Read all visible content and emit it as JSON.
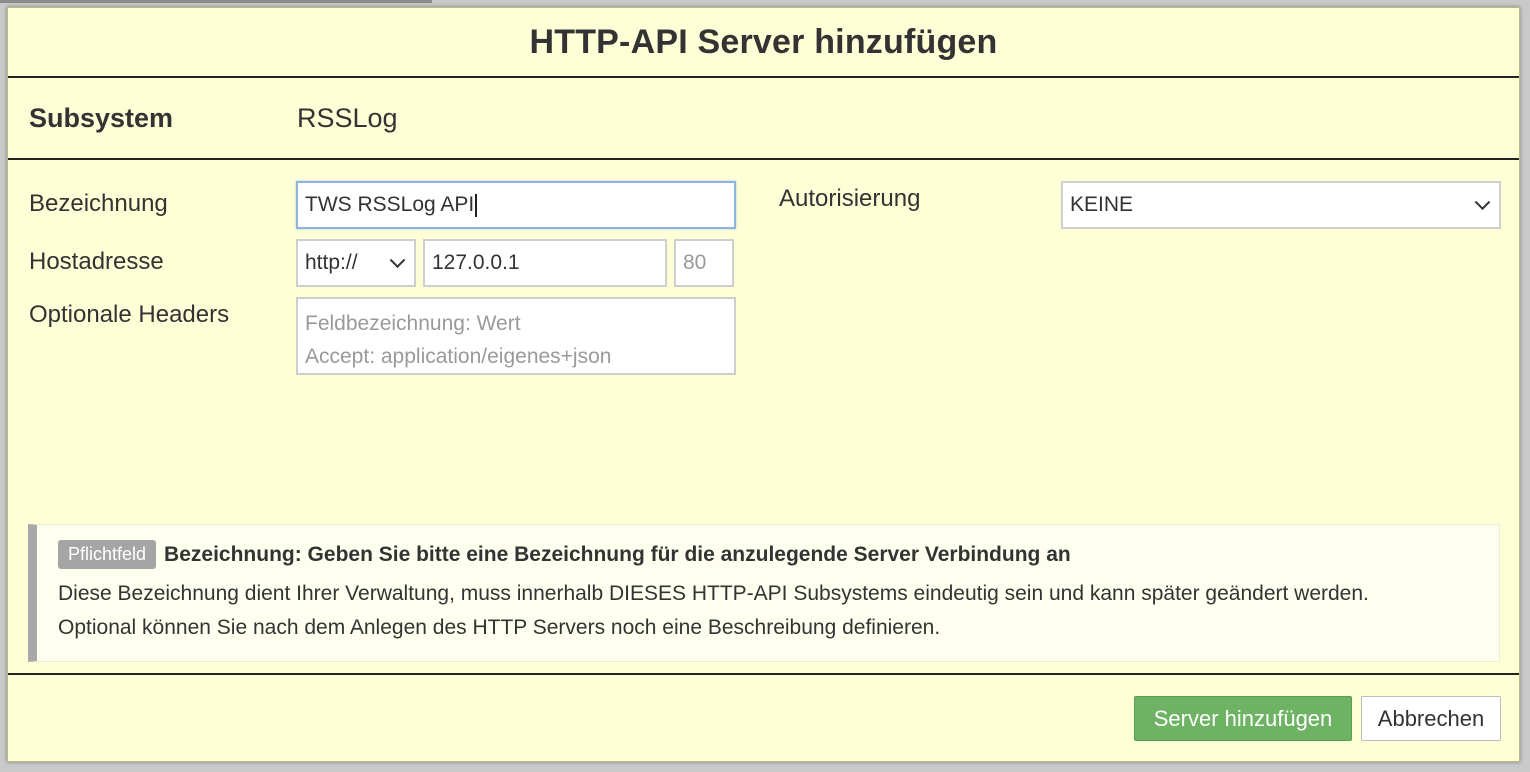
{
  "dialog": {
    "title": "HTTP-API Server hinzufügen",
    "subsystem": {
      "label": "Subsystem",
      "value": "RSSLog"
    }
  },
  "form": {
    "name": {
      "label": "Bezeichnung",
      "value": "TWS RSSLog API"
    },
    "host": {
      "label": "Hostadresse",
      "protocol": "http://",
      "address": "127.0.0.1",
      "port_placeholder": "80"
    },
    "headers": {
      "label": "Optionale Headers",
      "placeholder_line1": "Feldbezeichnung: Wert",
      "placeholder_line2": "Accept: application/eigenes+json"
    },
    "auth": {
      "label": "Autorisierung",
      "value": "KEINE"
    }
  },
  "info": {
    "badge": "Pflichtfeld",
    "title": "Bezeichnung: Geben Sie bitte eine Bezeichnung für die anzulegende Server Verbindung an",
    "line1": "Diese Bezeichnung dient Ihrer Verwaltung, muss innerhalb DIESES HTTP-API Subsystems eindeutig sein und kann später geändert werden.",
    "line2": "Optional können Sie nach dem Anlegen des HTTP Servers noch eine Beschreibung definieren."
  },
  "footer": {
    "submit_label": "Server hinzufügen",
    "cancel_label": "Abbrechen"
  }
}
